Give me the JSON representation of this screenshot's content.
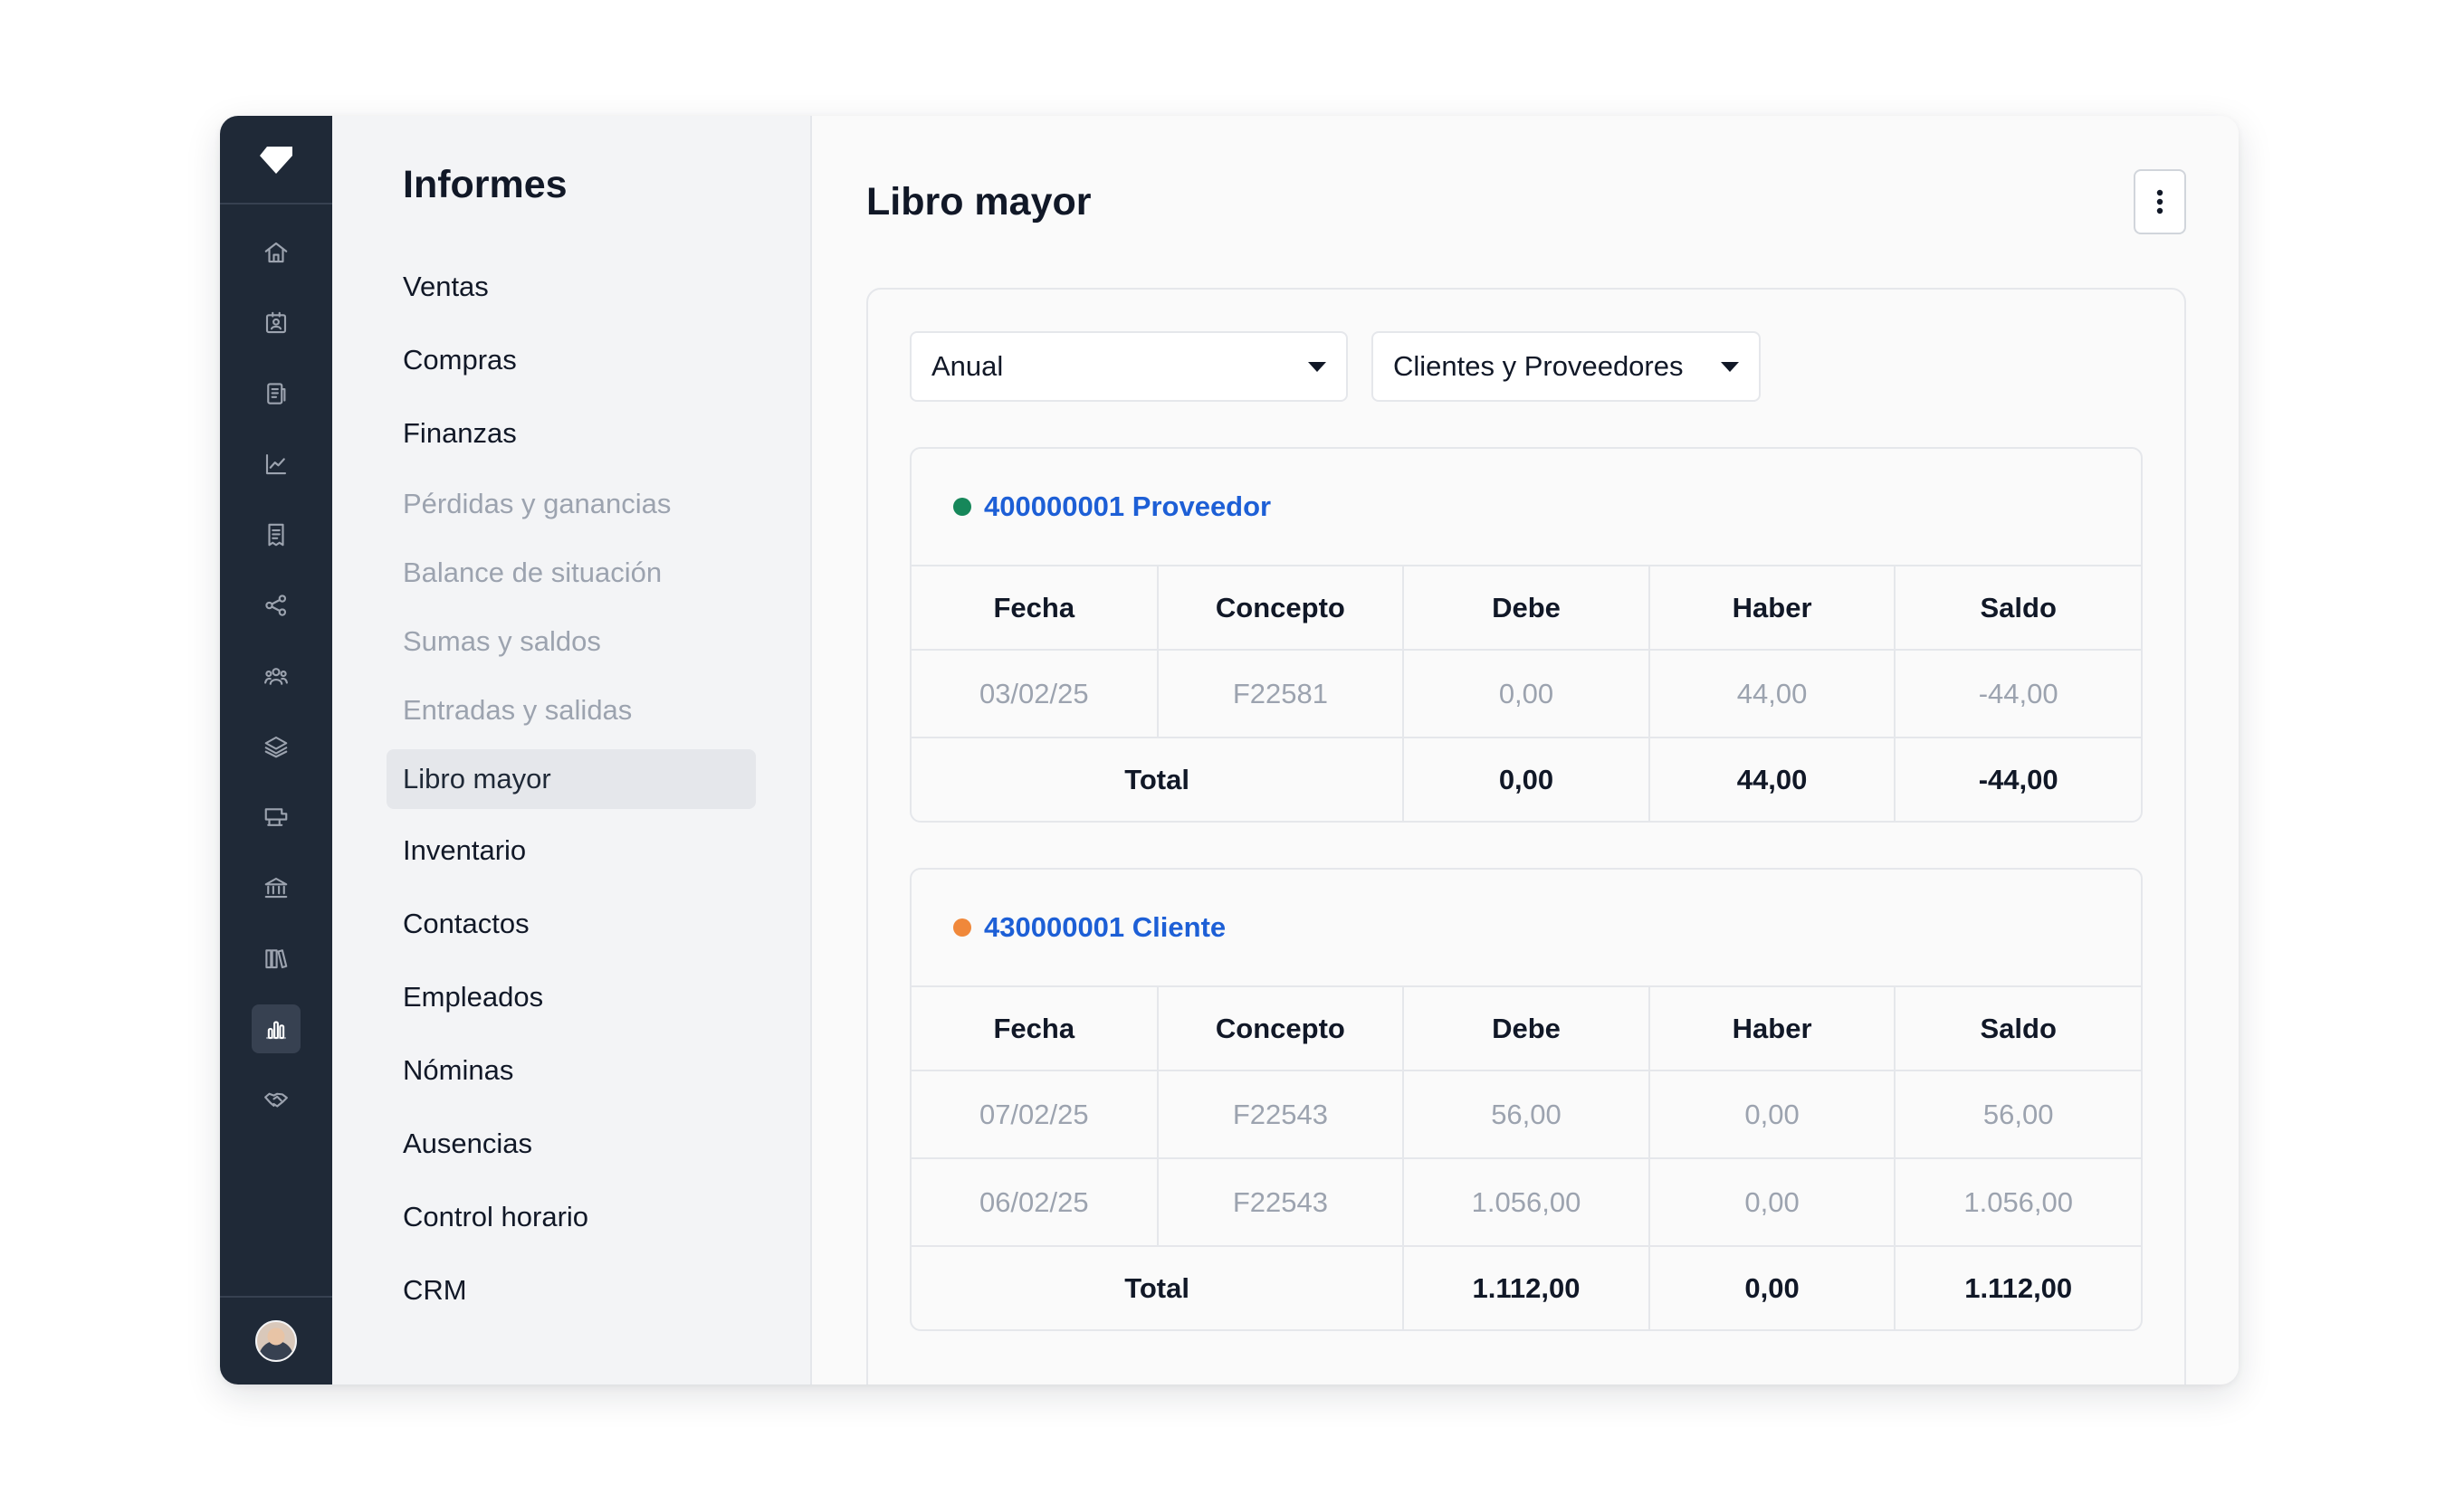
{
  "menu": {
    "title": "Informes",
    "items": [
      {
        "label": "Ventas",
        "type": "main"
      },
      {
        "label": "Compras",
        "type": "main"
      },
      {
        "label": "Finanzas",
        "type": "main"
      },
      {
        "label": "Pérdidas y ganancias",
        "type": "sub"
      },
      {
        "label": "Balance de situación",
        "type": "sub"
      },
      {
        "label": "Sumas y saldos",
        "type": "sub"
      },
      {
        "label": "Entradas y salidas",
        "type": "sub"
      },
      {
        "label": "Libro mayor",
        "type": "sub-active"
      },
      {
        "label": "Inventario",
        "type": "main"
      },
      {
        "label": "Contactos",
        "type": "main"
      },
      {
        "label": "Empleados",
        "type": "main"
      },
      {
        "label": "Nóminas",
        "type": "main"
      },
      {
        "label": "Ausencias",
        "type": "main"
      },
      {
        "label": "Control horario",
        "type": "main"
      },
      {
        "label": "CRM",
        "type": "main"
      }
    ]
  },
  "rail": {
    "icons": [
      "home-icon",
      "contact-card-icon",
      "document-icon",
      "chart-line-icon",
      "receipt-icon",
      "share-icon",
      "users-icon",
      "layers-icon",
      "truck-icon",
      "bank-icon",
      "books-icon",
      "bar-chart-icon",
      "handshake-icon"
    ],
    "active_index": 11
  },
  "main": {
    "title": "Libro mayor",
    "filters": {
      "period": "Anual",
      "contacts": "Clientes y Proveedores"
    },
    "columns": [
      "Fecha",
      "Concepto",
      "Debe",
      "Haber",
      "Saldo"
    ],
    "total_label": "Total",
    "accounts": [
      {
        "name": "400000001 Proveedor",
        "dot_color": "#16875a",
        "rows": [
          {
            "fecha": "03/02/25",
            "concepto": "F22581",
            "debe": "0,00",
            "haber": "44,00",
            "saldo": "-44,00"
          }
        ],
        "total": {
          "debe": "0,00",
          "haber": "44,00",
          "saldo": "-44,00"
        }
      },
      {
        "name": "430000001 Cliente",
        "dot_color": "#f0883a",
        "rows": [
          {
            "fecha": "07/02/25",
            "concepto": "F22543",
            "debe": "56,00",
            "haber": "0,00",
            "saldo": "56,00"
          },
          {
            "fecha": "06/02/25",
            "concepto": "F22543",
            "debe": "1.056,00",
            "haber": "0,00",
            "saldo": "1.056,00"
          }
        ],
        "total": {
          "debe": "1.112,00",
          "haber": "0,00",
          "saldo": "1.112,00"
        }
      }
    ]
  },
  "colors": {
    "rail": "#1f2937",
    "link": "#1d5fd6"
  }
}
